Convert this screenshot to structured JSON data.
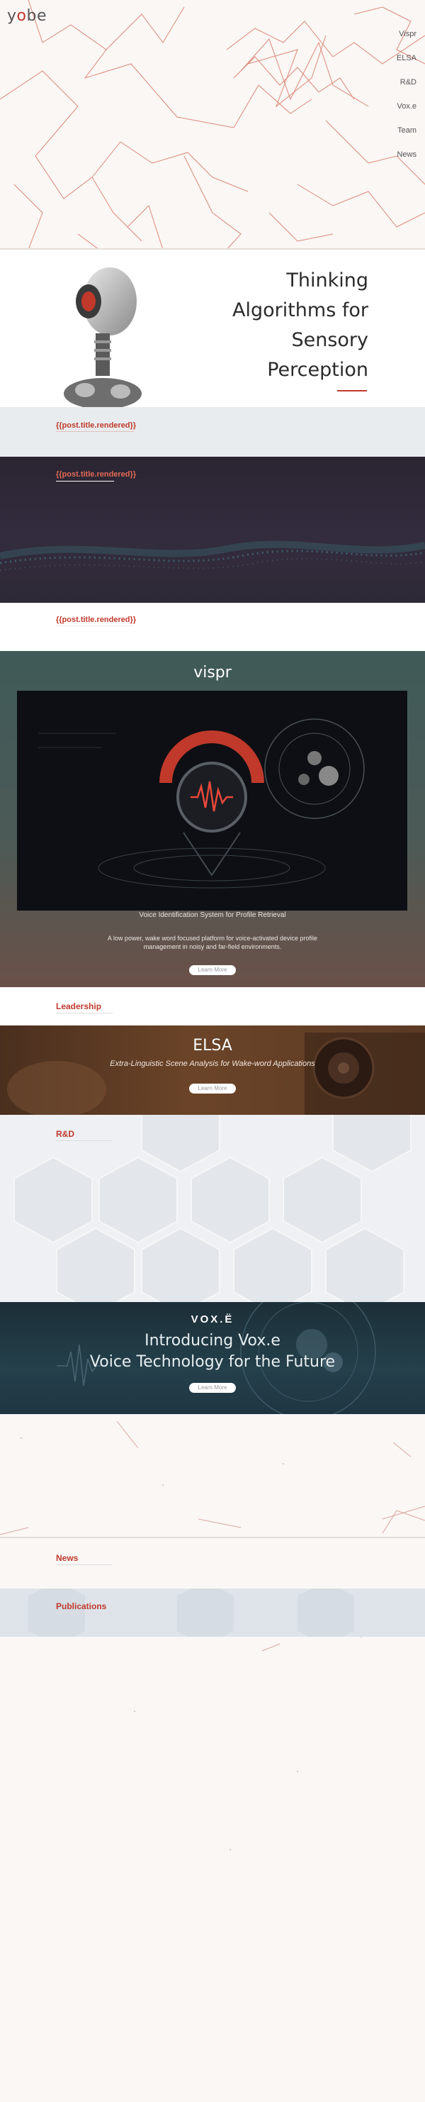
{
  "header": {
    "logo_text_1": "y",
    "logo_text_2": "o",
    "logo_text_3": "be",
    "nav": [
      "Vispr",
      "ELSA",
      "R&D",
      "Vox.e",
      "Team",
      "News"
    ]
  },
  "intro": {
    "headline_lines": [
      "Thinking",
      "Algorithms for",
      "Sensory",
      "Perception"
    ]
  },
  "posts": {
    "title_1": "{{post.title.rendered}}",
    "title_2": "{{post.title.rendered}}",
    "title_3": "{{post.title.rendered}}"
  },
  "vispr": {
    "logo": "vispr",
    "subtitle": "Voice Identification System for Profile Retrieval",
    "description_1": "A low power, wake word focused platform for voice-activated device profile",
    "description_2": "management in noisy and far-field environments.",
    "button_label": "Learn More"
  },
  "leadership": {
    "heading": "Leadership"
  },
  "elsa": {
    "title": "ELSA",
    "subtitle": "Extra-Linguistic Scene Analysis for Wake-word Applications",
    "button_label": "Learn More"
  },
  "rnd": {
    "heading": "R&D"
  },
  "voxe": {
    "logo": "VOX.Ë",
    "headline_1": "Introducing Vox.e",
    "headline_2": "Voice Technology for the Future",
    "button_label": "Learn More"
  },
  "news": {
    "heading": "News"
  },
  "publications": {
    "heading": "Publications"
  },
  "colors": {
    "accent": "#c0392b",
    "background": "#faf7f5",
    "dark_band": "#2e2a38",
    "elsa_band": "#5a3a24",
    "voxe_band": "#1f3a45"
  }
}
